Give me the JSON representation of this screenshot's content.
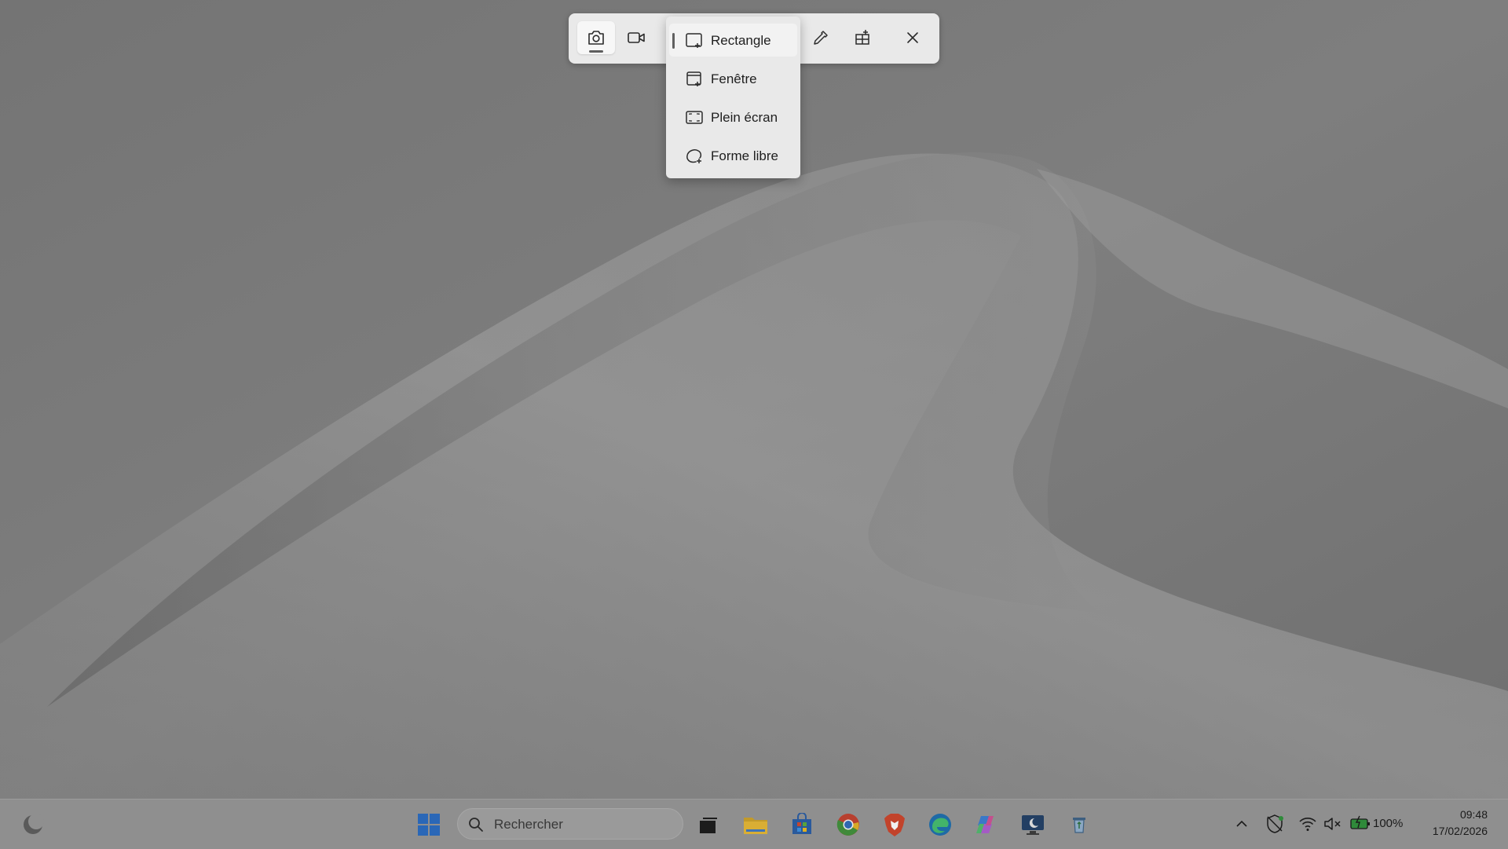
{
  "snip_toolbar": {
    "modes": [
      {
        "id": "screenshot",
        "icon": "camera-icon",
        "active": true
      },
      {
        "id": "video",
        "icon": "video-camera-icon",
        "active": false
      }
    ],
    "tools": [
      {
        "id": "color-picker",
        "icon": "eyedropper-icon"
      },
      {
        "id": "text-actions",
        "icon": "add-grid-icon"
      },
      {
        "id": "close",
        "icon": "close-icon"
      }
    ]
  },
  "mode_menu": {
    "items": [
      {
        "label": "Rectangle",
        "icon": "rectangle-snip-icon",
        "selected": true
      },
      {
        "label": "Fenêtre",
        "icon": "window-snip-icon",
        "selected": false
      },
      {
        "label": "Plein écran",
        "icon": "fullscreen-snip-icon",
        "selected": false
      },
      {
        "label": "Forme libre",
        "icon": "freeform-snip-icon",
        "selected": false
      }
    ]
  },
  "taskbar": {
    "search_placeholder": "Rechercher",
    "apps": [
      "start-icon",
      "task-view-icon",
      "file-explorer-icon",
      "store-icon",
      "chrome-icon",
      "brave-icon",
      "edge-icon",
      "copilot-icon",
      "remote-desktop-icon",
      "recycle-icon"
    ],
    "tray": {
      "battery": "100%",
      "time": "09:48",
      "date": "17/02/2026"
    }
  },
  "colors": {
    "desktop_dim": "#7b7b7b",
    "toolbar_bg": "#e9e9e9",
    "taskbar_bg": "#8f8f8f",
    "start_blue": "#2a67b7"
  }
}
